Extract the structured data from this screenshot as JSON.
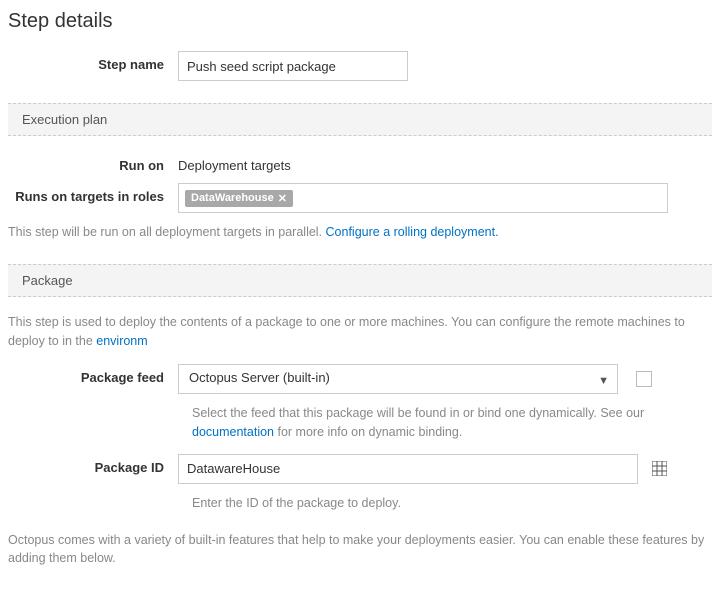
{
  "pageTitle": "Step details",
  "stepName": {
    "label": "Step name",
    "value": "Push seed script package"
  },
  "sections": {
    "execution": "Execution plan",
    "package": "Package"
  },
  "runOn": {
    "label": "Run on",
    "value": "Deployment targets"
  },
  "roles": {
    "label": "Runs on targets in roles",
    "tag": "DataWarehouse",
    "tagRemove": "✕"
  },
  "executionHelp": {
    "prefix": "This step will be run on all deployment targets in parallel. ",
    "link": "Configure a rolling deployment."
  },
  "packageDesc": {
    "prefix": "This step is used to deploy the contents of a package to one or more machines. You can configure the remote machines to deploy to in the ",
    "link": "environm"
  },
  "packageFeed": {
    "label": "Package feed",
    "selected": "Octopus Server (built-in)",
    "help1": "Select the feed that this package will be found in or bind one dynamically. See our ",
    "helpLink": "documentation",
    "help2": " for more info on dynamic binding."
  },
  "packageId": {
    "label": "Package ID",
    "value": "DatawareHouse",
    "help": "Enter the ID of the package to deploy."
  },
  "featuresText": "Octopus comes with a variety of built-in features that help to make your deployments easier. You can enable these features by adding them below."
}
